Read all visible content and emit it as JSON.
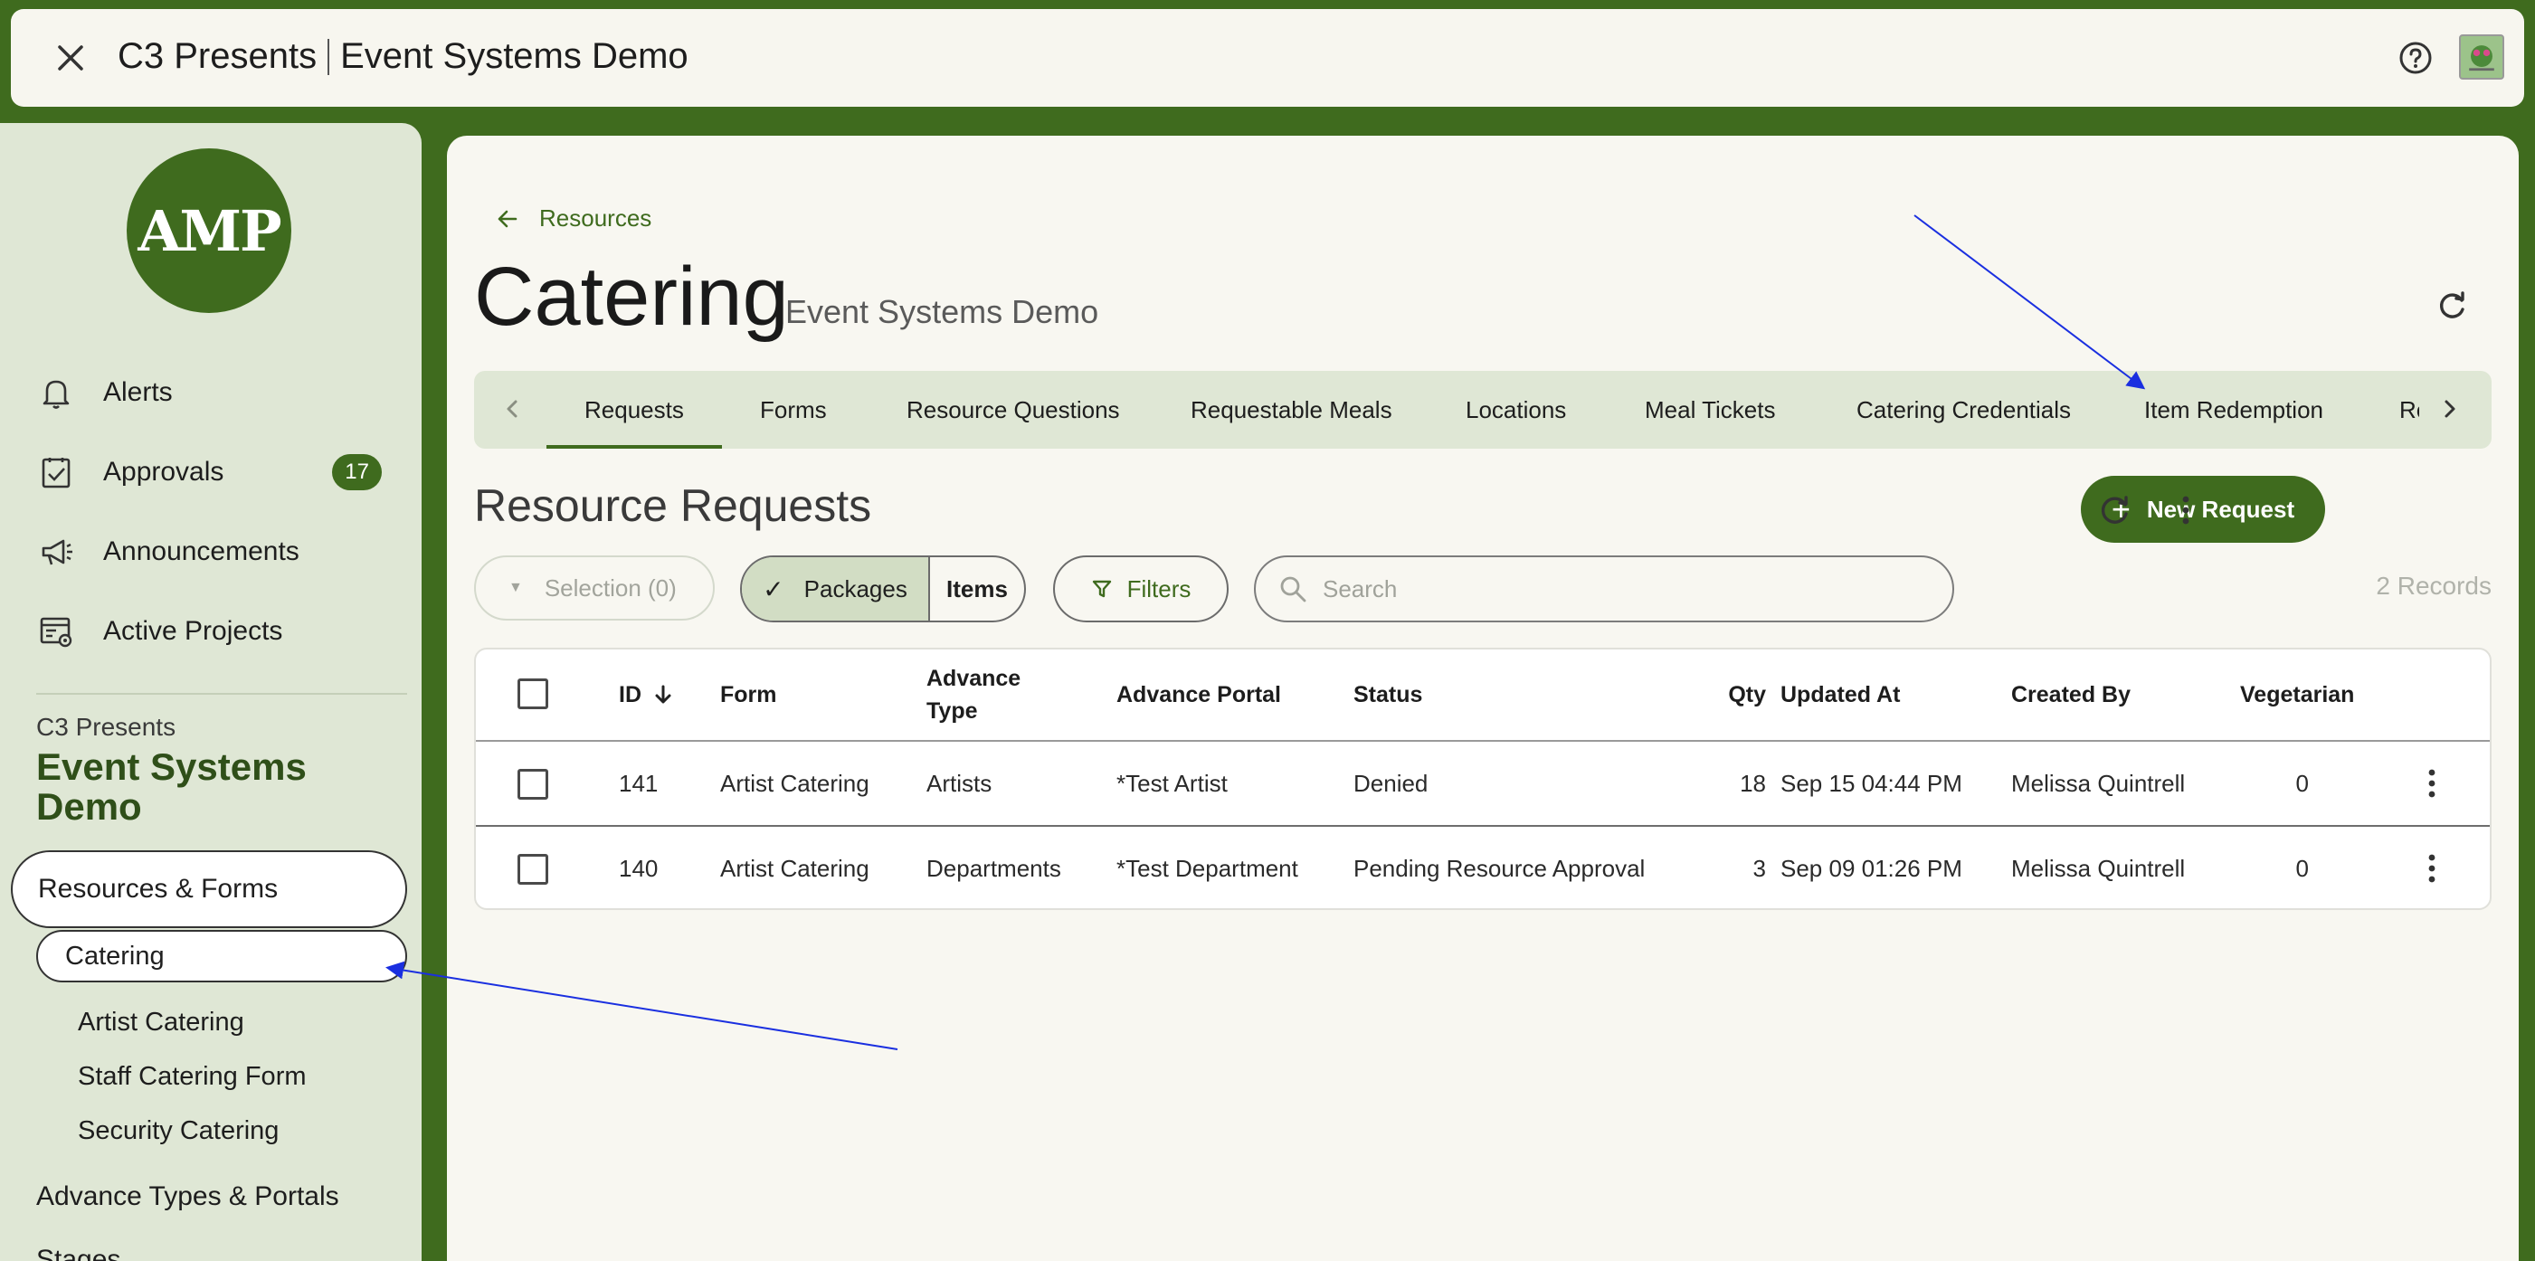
{
  "topbar": {
    "org": "C3 Presents",
    "project": "Event Systems Demo"
  },
  "sidebar": {
    "logo_text": "AMP",
    "nav": [
      {
        "label": "Alerts",
        "icon": "bell-icon"
      },
      {
        "label": "Approvals",
        "icon": "clipboard-check-icon",
        "badge": "17"
      },
      {
        "label": "Announcements",
        "icon": "megaphone-icon"
      },
      {
        "label": "Active Projects",
        "icon": "project-list-icon"
      }
    ],
    "project_org": "C3 Presents",
    "project_name": "Event Systems Demo",
    "resources_forms": "Resources & Forms",
    "catering": "Catering",
    "sub_items": [
      "Artist Catering",
      "Staff Catering Form",
      "Security Catering"
    ],
    "advance_types": "Advance Types & Portals",
    "stages": "Stages"
  },
  "main": {
    "back_label": "Resources",
    "title": "Catering",
    "subtitle": "Event Systems Demo",
    "tabs": [
      "Requests",
      "Forms",
      "Resource Questions",
      "Requestable Meals",
      "Locations",
      "Meal Tickets",
      "Catering Credentials",
      "Item Redemption",
      "Re"
    ],
    "active_tab": "Requests",
    "section_title": "Resource Requests",
    "new_request": "New Request",
    "selection": "Selection (0)",
    "segment": {
      "packages": "Packages",
      "items": "Items",
      "selected": "Packages"
    },
    "filters": "Filters",
    "search_placeholder": "Search",
    "records": "2 Records"
  },
  "table": {
    "headers": {
      "id": "ID",
      "form": "Form",
      "advance_type_1": "Advance",
      "advance_type_2": "Type",
      "advance_portal": "Advance Portal",
      "status": "Status",
      "qty": "Qty",
      "updated_at": "Updated At",
      "created_by": "Created By",
      "vegetarian": "Vegetarian"
    },
    "sort": {
      "column": "ID",
      "direction": "desc"
    },
    "rows": [
      {
        "id": "141",
        "form": "Artist Catering",
        "advance_type": "Artists",
        "advance_portal": "*Test Artist",
        "status": "Denied",
        "qty": "18",
        "updated_at": "Sep 15 04:44 PM",
        "created_by": "Melissa Quintrell",
        "vegetarian": "0"
      },
      {
        "id": "140",
        "form": "Artist Catering",
        "advance_type": "Departments",
        "advance_portal": "*Test Department",
        "status": "Pending Resource Approval",
        "qty": "3",
        "updated_at": "Sep 09 01:26 PM",
        "created_by": "Melissa Quintrell",
        "vegetarian": "0"
      }
    ]
  },
  "colors": {
    "brand_green": "#3f6b1e",
    "sidebar_bg": "#dfe7d5",
    "panel_bg": "#f8f7f1",
    "annotation_arrow": "#1a2fe0"
  }
}
